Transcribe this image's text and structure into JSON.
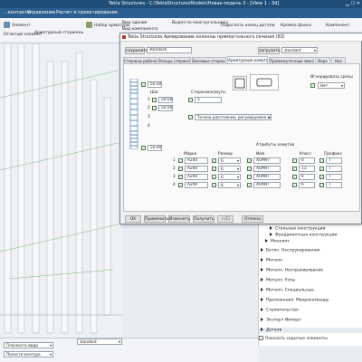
{
  "window": {
    "title": "Tekla Structures - C:\\TeklaStructuresModels\\Новая модель 3 - [View 1 - 3d]"
  },
  "menu": [
    "...контакты",
    "Управление",
    "Расчет и проектирование"
  ],
  "ribbon": {
    "items": [
      "Элемент",
      "Арматурный стержень",
      "Набор арматуры",
      "Вид здания",
      "Вид компонента",
      "Вырез по многоугольнику",
      "Подогнать конец детали",
      "Кромка фаски",
      "Компонент",
      "Отлитый элемент"
    ]
  },
  "dialog": {
    "title": "Tekla Structures  Армирование колонны прямоугольного сечения (83)",
    "save_label": "сохранить",
    "save_value": "standard",
    "load_label": "загрузить",
    "load_value": "standard",
    "tabs": [
      "Стержни рабочие",
      "Концы стержня",
      "Боковые стержни",
      "Арматурные хомуты",
      "Промежуточные звенья",
      "Верх",
      "Низ"
    ],
    "active_tab": 3,
    "values": [
      "50.00",
      "50.00",
      "50.00",
      "50.00"
    ],
    "markers": [
      "1",
      "2",
      "3",
      "4"
    ],
    "labels": {
      "step": "Шаг",
      "hook": "Стержни/хомуты",
      "ignore": "Игнорировать срезы",
      "ignore_value": "Нет",
      "count_value": "5",
      "option": "Точное расстояние, регулируемое на к...",
      "attrs": "Атрибуты хомутов"
    },
    "columns": [
      "Марка",
      "Размер",
      "Имя",
      "Класс",
      "Префикс"
    ],
    "rows": [
      {
        "n": "1",
        "mark": "A240",
        "size": "6",
        "name": "ХОМУТ",
        "cls": "6",
        "prefix": "Т"
      },
      {
        "n": "2",
        "mark": "A240",
        "size": "6",
        "name": "ХОМУТ",
        "cls": "11",
        "prefix": "Т"
      },
      {
        "n": "3",
        "mark": "A240",
        "size": "6",
        "name": "ХОМУТ",
        "cls": "6",
        "prefix": "Т"
      },
      {
        "n": "4",
        "mark": "A240",
        "size": "6",
        "name": "ХОМУТ",
        "cls": "6",
        "prefix": "Т"
      }
    ],
    "buttons": {
      "ok": "OK",
      "apply": "Применить",
      "modify": "Изменить",
      "get": "Получить",
      "toggle": "✓/☐",
      "cancel": "Отмена"
    }
  },
  "tree": {
    "items": [
      {
        "label": "Стальные конструкции",
        "indent": 2
      },
      {
        "label": "Фундаментные конструкции",
        "indent": 2
      },
      {
        "label": "Монолит",
        "indent": 1
      },
      {
        "label": "Бетон. Неспрукирование",
        "indent": 0
      },
      {
        "label": "Металл",
        "indent": 0
      },
      {
        "label": "Металл. Неспрукирование",
        "indent": 0
      },
      {
        "label": "Металл. Узлы",
        "indent": 0
      },
      {
        "label": "Металл. Специальные",
        "indent": 0
      },
      {
        "label": "Приложения. Макрокоманды",
        "indent": 0
      },
      {
        "label": "Строительство",
        "indent": 0
      },
      {
        "label": "Экспорт Импорт",
        "indent": 0
      },
      {
        "label": "Детали",
        "indent": 0
      },
      {
        "label": "Детализация",
        "indent": 0
      },
      {
        "label": "Приложения",
        "indent": 0
      },
      {
        "label": "Создание",
        "indent": 0
      },
      {
        "label": "Узлы",
        "indent": 0
      }
    ],
    "footer": "Показать скрытые элементы"
  },
  "status": {
    "field1": "Плоскость вида",
    "field2": "Полости контура",
    "field3": "standard"
  },
  "colors": {
    "title": "#1f4e79",
    "menu": "#2b5f8f",
    "accent": "#1a7a1a",
    "rebar_blue": "#3b6bb0"
  }
}
